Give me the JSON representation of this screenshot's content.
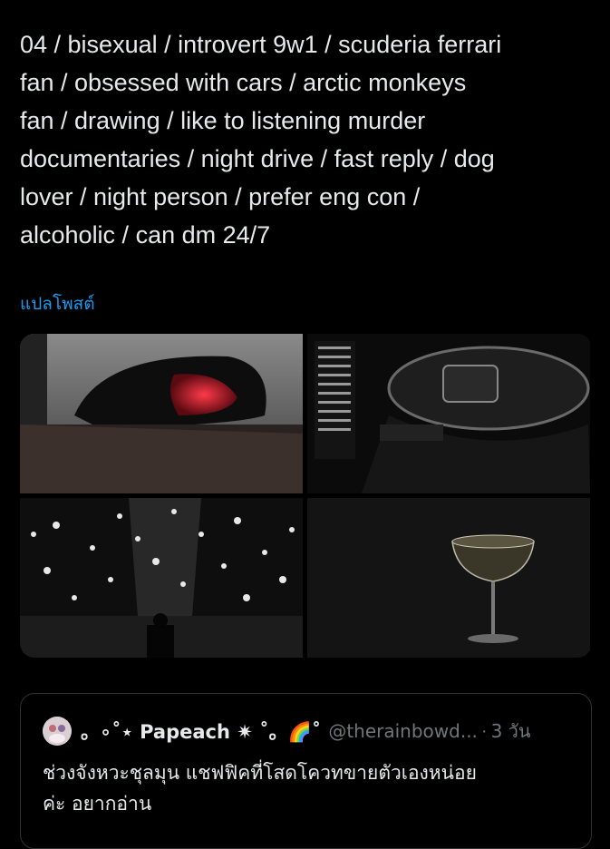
{
  "post": {
    "text": "04 / bisexual / introvert 9w1 / scuderia ferrari\nfan / obsessed with cars / arctic monkeys\nfan / drawing / like to listening murder\ndocumentaries / night drive / fast reply / dog\nlover / night person / prefer eng con /\nalcoholic / can dm 24/7",
    "translate_label": "แปลโพสต์"
  },
  "media": {
    "items": [
      {
        "name": "car-side-mirror-photo"
      },
      {
        "name": "f1-steering-wheel-photo"
      },
      {
        "name": "concert-stage-photo"
      },
      {
        "name": "cocktail-glass-photo"
      }
    ]
  },
  "quote": {
    "display_name": "。∘˚⋆ Papeach ✷ ˚。🌈˚",
    "handle": "@therainbowd...",
    "separator": "·",
    "time": "3 วัน",
    "text": "ช่วงจังหวะชุลมุน แชฟฟิคที่โสดโควทขายตัวเองหน่อย\nค่ะ อยากอ่าน"
  },
  "colors": {
    "background": "#000000",
    "text": "#e7e9ea",
    "link": "#1d9bf0",
    "muted": "#71767b",
    "border": "#2f3336"
  }
}
